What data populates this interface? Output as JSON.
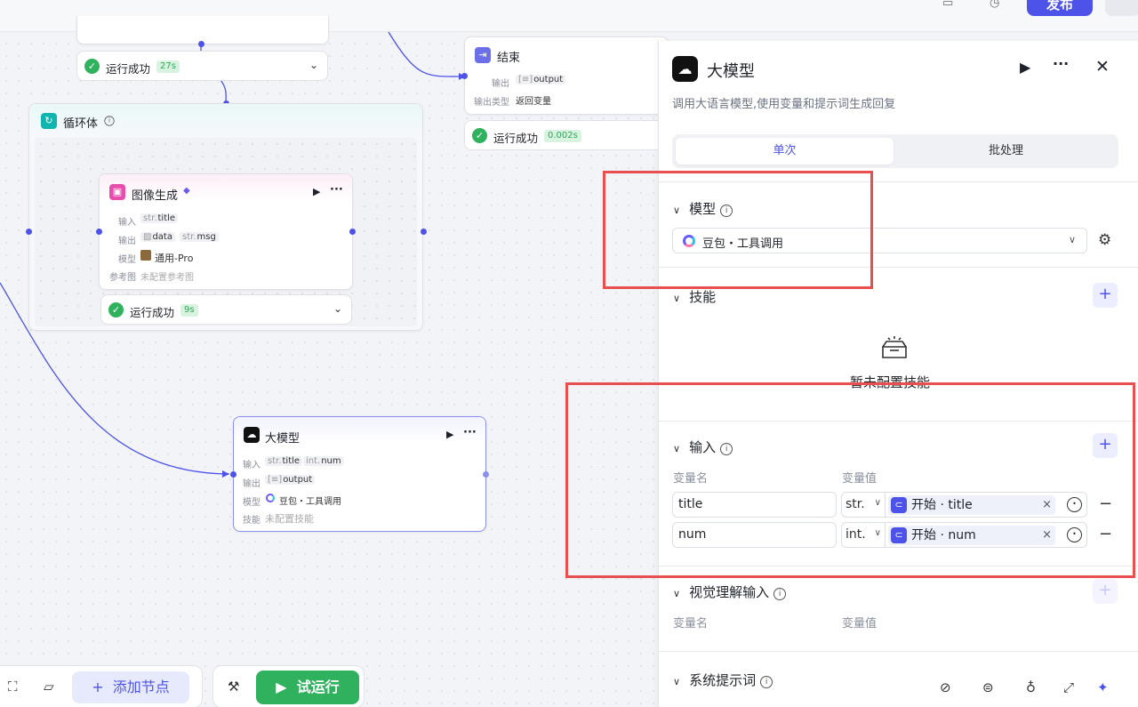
{
  "topbar": {
    "publish_label": "发布"
  },
  "canvas": {
    "node_top_status": {
      "label": "运行成功",
      "time": "27s"
    },
    "end_node": {
      "title": "结束",
      "output_key": "输出",
      "output_chip": "output",
      "output_type_key": "输出类型",
      "output_type_value": "返回变量",
      "status_label": "运行成功",
      "status_time": "0.002s"
    },
    "loop_node": {
      "title": "循环体"
    },
    "image_node": {
      "title": "图像生成",
      "input_key": "输入",
      "input_chip_type": "str.",
      "input_chip_name": "title",
      "output_key": "输出",
      "output_chip1": "data",
      "output_chip2_type": "str.",
      "output_chip2_name": "msg",
      "model_key": "模型",
      "model_value": "通用-Pro",
      "ref_key": "参考图",
      "ref_value": "未配置参考图",
      "status_label": "运行成功",
      "status_time": "9s"
    },
    "llm_node": {
      "title": "大模型",
      "input_key": "输入",
      "chip1_type": "str.",
      "chip1_name": "title",
      "chip2_type": "int.",
      "chip2_name": "num",
      "output_key": "输出",
      "output_chip": "output",
      "model_key": "模型",
      "model_value": "豆包・工具调用",
      "skill_key": "技能",
      "skill_value": "未配置技能"
    }
  },
  "panel": {
    "title": "大模型",
    "description": "调用大语言模型,使用变量和提示词生成回复",
    "tabs": [
      "单次",
      "批处理"
    ],
    "model_section": {
      "title": "模型",
      "selected_model": "豆包・工具调用"
    },
    "skill_section": {
      "title": "技能",
      "empty_text": "暂未配置技能"
    },
    "input_section": {
      "title": "输入",
      "col_name": "变量名",
      "col_value": "变量值",
      "rows": [
        {
          "name": "title",
          "type": "str.",
          "ref": "开始 · title"
        },
        {
          "name": "num",
          "type": "int.",
          "ref": "开始 · num"
        }
      ]
    },
    "vision_section": {
      "title": "视觉理解输入",
      "col_name": "变量名",
      "col_value": "变量值"
    },
    "system_prompt_section": {
      "title": "系统提示词"
    }
  },
  "toolbar": {
    "add_node_label": "添加节点",
    "run_label": "试运行"
  },
  "colors": {
    "accent": "#4d53e8",
    "success": "#2fb15e",
    "highlight_box": "#e94f4f"
  }
}
